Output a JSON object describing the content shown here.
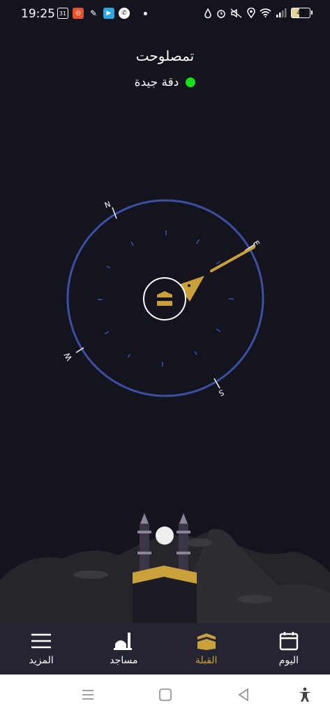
{
  "status_bar": {
    "time": "19:25",
    "calendar_day": "31",
    "battery_level": "43",
    "notification_icons": [
      "calendar-icon",
      "app-icon-orange",
      "translate-icon",
      "app-icon-blue",
      "whatsapp-icon",
      "dot-icon"
    ],
    "system_icons": [
      "drop-icon",
      "alarm-icon",
      "mute-icon",
      "location-icon",
      "wifi-icon",
      "signal-icon",
      "battery-icon"
    ]
  },
  "header": {
    "location": "تمصلوحت",
    "accuracy_label": "دقة جيدة",
    "accuracy_color": "#16e019"
  },
  "compass": {
    "labels": {
      "north": "N",
      "east": "E",
      "south": "S",
      "west": "W"
    },
    "ring_color": "#3d4fa3",
    "needle_color": "#c9a03a"
  },
  "bottom_nav": {
    "items": [
      {
        "label": "اليوم",
        "icon": "calendar-icon",
        "active": false
      },
      {
        "label": "القبلة",
        "icon": "kaaba-icon",
        "active": true
      },
      {
        "label": "مساجد",
        "icon": "mosque-icon",
        "active": false
      },
      {
        "label": "المزيد",
        "icon": "menu-icon",
        "active": false
      }
    ],
    "active_color": "#c9a03a"
  },
  "system_nav": {
    "buttons": [
      "recents-button",
      "home-button",
      "back-button",
      "accessibility-button"
    ]
  }
}
